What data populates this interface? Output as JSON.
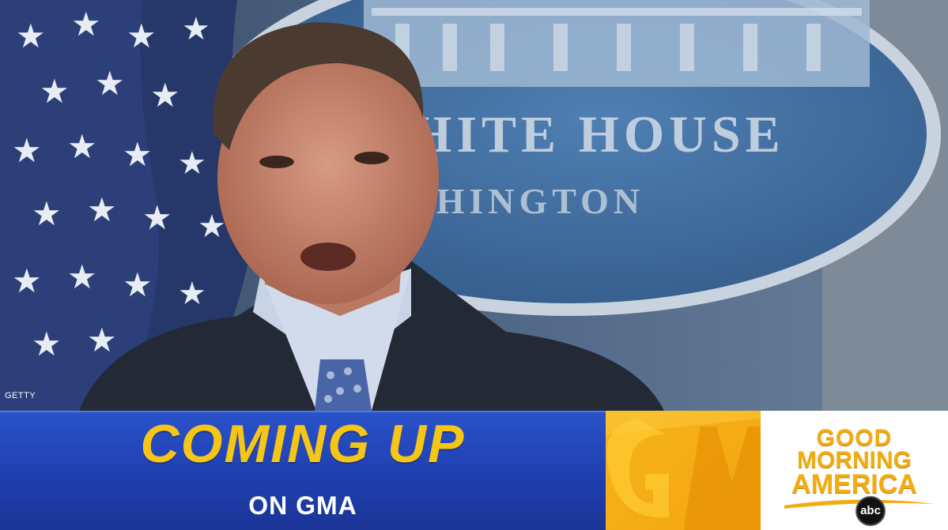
{
  "photo": {
    "credit": "GETTY",
    "podium_seal_text_line1": "HITE HOUSE",
    "podium_seal_text_line2": "SHINGTON"
  },
  "banner": {
    "headline": "COMING UP",
    "subline": "ON GMA",
    "headline_color": "#f5c518",
    "panel_color": "#2349c0"
  },
  "logo": {
    "line1": "GOOD",
    "line2": "MORNING",
    "line3": "AMERICA",
    "network": "abc",
    "color": "#f2ac12"
  }
}
